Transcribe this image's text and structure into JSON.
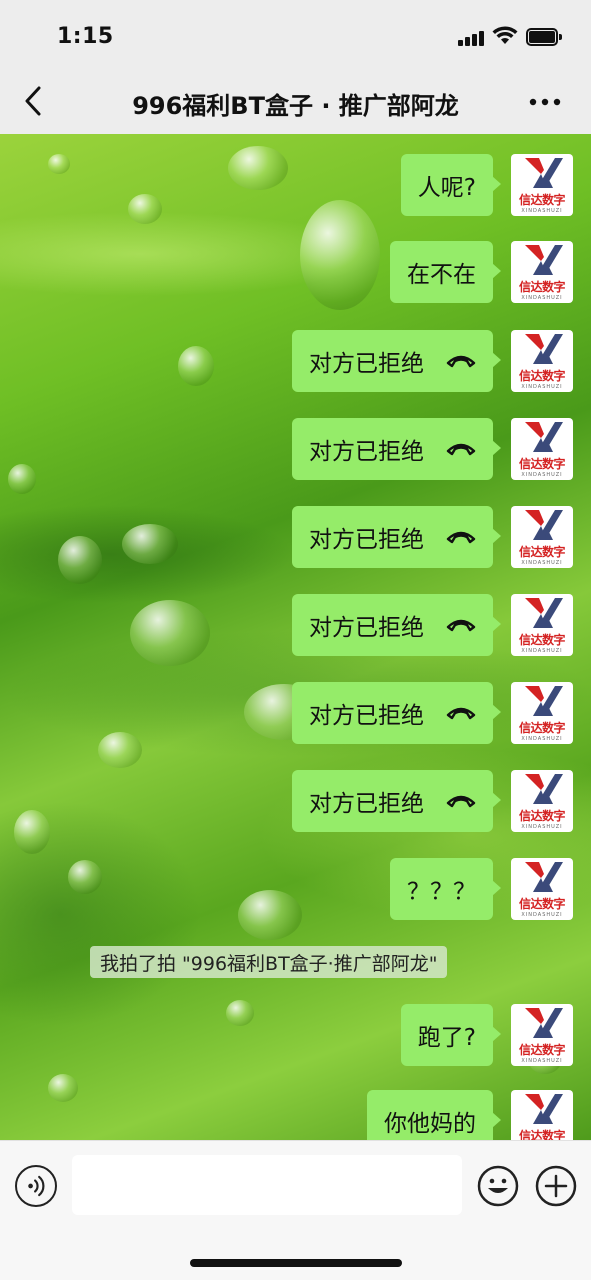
{
  "status_bar": {
    "time": "1:15"
  },
  "header": {
    "title": "996福利BT盒子 · 推广部阿龙"
  },
  "avatar": {
    "name": "信达数字",
    "subtitle": "XINDASHUZI"
  },
  "messages": [
    {
      "text": "人呢?",
      "call": false
    },
    {
      "text": "在不在",
      "call": false
    },
    {
      "text": "对方已拒绝",
      "call": true
    },
    {
      "text": "对方已拒绝",
      "call": true
    },
    {
      "text": "对方已拒绝",
      "call": true
    },
    {
      "text": "对方已拒绝",
      "call": true
    },
    {
      "text": "对方已拒绝",
      "call": true
    },
    {
      "text": "对方已拒绝",
      "call": true
    },
    {
      "text": "？？？",
      "call": false
    },
    {
      "text": "跑了?",
      "call": false
    },
    {
      "text": "你他妈的",
      "call": false
    }
  ],
  "system_message": "我拍了拍 \"996福利BT盒子·推广部阿龙\"",
  "input": {
    "value": "",
    "placeholder": ""
  },
  "colors": {
    "bubble": "#95ec69",
    "brand_red": "#d42323",
    "brand_navy": "#3b4a7a"
  },
  "icons": [
    "back-icon",
    "more-icon",
    "phone-hangup-icon",
    "voice-icon",
    "emoji-icon",
    "plus-icon"
  ]
}
